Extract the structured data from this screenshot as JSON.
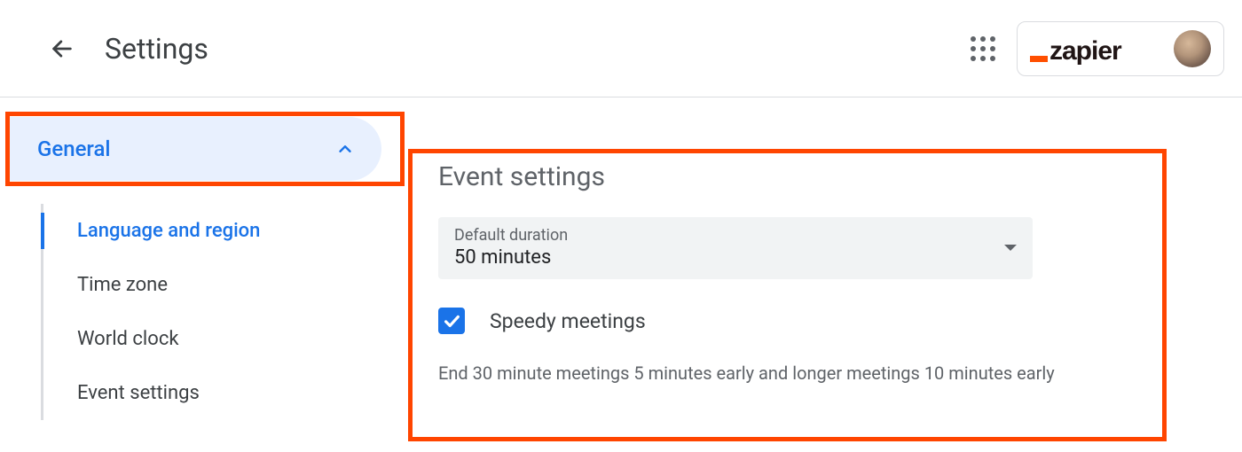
{
  "header": {
    "title": "Settings",
    "brand": "zapier"
  },
  "sidebar": {
    "section": {
      "label": "General",
      "expanded": true
    },
    "items": [
      {
        "label": "Language and region",
        "active": true
      },
      {
        "label": "Time zone",
        "active": false
      },
      {
        "label": "World clock",
        "active": false
      },
      {
        "label": "Event settings",
        "active": false
      }
    ]
  },
  "main": {
    "section_title": "Event settings",
    "duration": {
      "label": "Default duration",
      "value": "50 minutes"
    },
    "speedy": {
      "label": "Speedy meetings",
      "checked": true,
      "helper": "End 30 minute meetings 5 minutes early and longer meetings 10 minutes early"
    }
  }
}
